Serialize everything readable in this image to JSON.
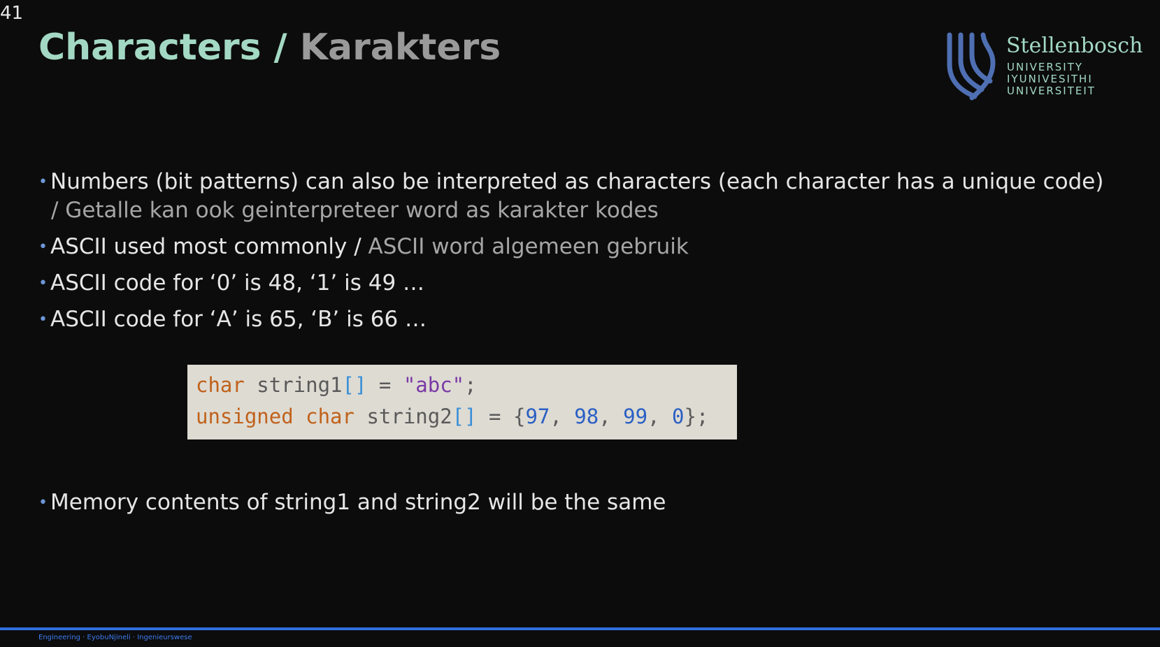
{
  "slide": {
    "number": "41",
    "title_en": "Characters",
    "title_sep": " / ",
    "title_af": "Karakters"
  },
  "logo": {
    "name": "Stellenbosch",
    "line1": "UNIVERSITY",
    "line2": "IYUNIVESITHI",
    "line3": "UNIVERSITEIT",
    "color": "#a3d9c4",
    "crest_color": "#4f6fb3"
  },
  "bullets": [
    {
      "en": "Numbers (bit patterns) can also be interpreted as characters (each character has a unique code)",
      "af": "/ Getalle kan ook geinterpreteer word as karakter kodes"
    },
    {
      "en": "ASCII used most commonly",
      "sep": " / ",
      "af": "ASCII word algemeen gebruik"
    },
    {
      "en": "ASCII code for ‘0’ is 48, ‘1’ is 49 …"
    },
    {
      "en": "ASCII code for ‘A’ is 65, ‘B’ is 66 …"
    },
    {
      "en": "Memory contents of string1 and string2 will be the same"
    }
  ],
  "code": {
    "line1": {
      "kw": "char",
      "id": " string1",
      "br": "[]",
      "op": " = ",
      "str": "\"abc\"",
      "end": ";"
    },
    "line2": {
      "kw": "unsigned char",
      "id": " string2",
      "br": "[]",
      "op": " = ",
      "open": "{",
      "n1": "97",
      "n2": "98",
      "n3": "99",
      "n4": "0",
      "comma": ", ",
      "close": "};"
    }
  },
  "footer": {
    "text": "Engineering · EyobuNjineli · Ingenieurswese",
    "accent": "#2f6fe0"
  },
  "icons": {
    "bullet": "bullet-dot-icon",
    "crest": "university-crest-icon"
  }
}
